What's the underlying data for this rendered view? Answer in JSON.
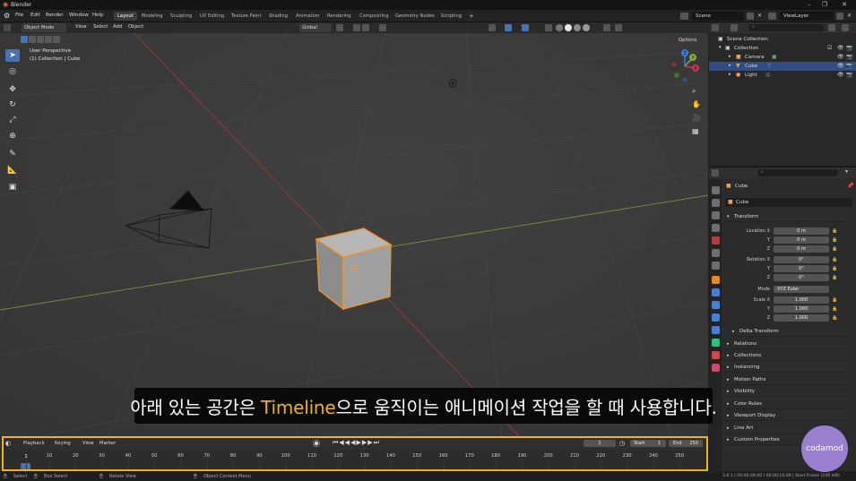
{
  "app": {
    "title": "Blender"
  },
  "menu": [
    "File",
    "Edit",
    "Render",
    "Window",
    "Help"
  ],
  "workspaces": [
    "Layout",
    "Modeling",
    "Sculpting",
    "UV Editing",
    "Texture Paint",
    "Shading",
    "Animation",
    "Rendering",
    "Compositing",
    "Geometry Nodes",
    "Scripting"
  ],
  "add_workspace": "+",
  "scene": {
    "label": "Scene",
    "view_layer": "ViewLayer"
  },
  "viewport_header": {
    "mode": "Object Mode",
    "menus": [
      "View",
      "Select",
      "Add",
      "Object"
    ],
    "orientation": "Global",
    "options": "Options"
  },
  "viewport": {
    "perspective": "User Perspective",
    "collection_path": "(1) Collection | Cube"
  },
  "gizmo": {
    "x": "X",
    "y": "Y",
    "z": "Z"
  },
  "outliner": {
    "items": [
      {
        "label": "Scene Collection"
      },
      {
        "label": "Collection"
      },
      {
        "label": "Camera"
      },
      {
        "label": "Cube"
      },
      {
        "label": "Light"
      }
    ]
  },
  "properties": {
    "object_name": "Cube",
    "data_name": "Cube",
    "transform": {
      "header": "Transform",
      "location": [
        {
          "label": "Location X",
          "value": "0 m"
        },
        {
          "label": "Y",
          "value": "0 m"
        },
        {
          "label": "Z",
          "value": "0 m"
        }
      ],
      "rotation": [
        {
          "label": "Rotation X",
          "value": "0°"
        },
        {
          "label": "Y",
          "value": "0°"
        },
        {
          "label": "Z",
          "value": "0°"
        }
      ],
      "mode_label": "Mode",
      "mode_value": "XYZ Euler",
      "scale": [
        {
          "label": "Scale X",
          "value": "1.000"
        },
        {
          "label": "Y",
          "value": "1.000"
        },
        {
          "label": "Z",
          "value": "1.000"
        }
      ],
      "delta": "Delta Transform"
    },
    "sections": [
      "Relations",
      "Collections",
      "Instancing",
      "Motion Paths",
      "Visibility",
      "Color Rules",
      "Viewport Display",
      "Line Art",
      "Custom Properties"
    ]
  },
  "timeline": {
    "menus": [
      "Playback",
      "Keying",
      "View",
      "Marker"
    ],
    "current_frame": "1",
    "start_label": "Start",
    "start": "1",
    "end_label": "End",
    "end": "250",
    "ruler": [
      "1",
      "10",
      "20",
      "30",
      "40",
      "50",
      "60",
      "70",
      "80",
      "90",
      "100",
      "110",
      "120",
      "130",
      "140",
      "150",
      "160",
      "170",
      "180",
      "190",
      "200",
      "210",
      "220",
      "230",
      "240",
      "250"
    ]
  },
  "status": {
    "select": "Select",
    "box_select": "Box Select",
    "rotate_view": "Rotate View",
    "context_menu": "Object Context Menu",
    "right": "3.0.1 | 00:00:00:00 / 00:00:10:09 | Start Frame (249 left)"
  },
  "subtitle": {
    "pre": "아래 있는 공간은 ",
    "highlight": "Timeline",
    "post": "으로 움직이는 애니메이션 작업을 할 때 사용합니다."
  },
  "watermark": "codamod",
  "colors": {
    "accent": "#4772b3",
    "highlight": "#f2b21a",
    "selected_outline": "#f0961e"
  }
}
